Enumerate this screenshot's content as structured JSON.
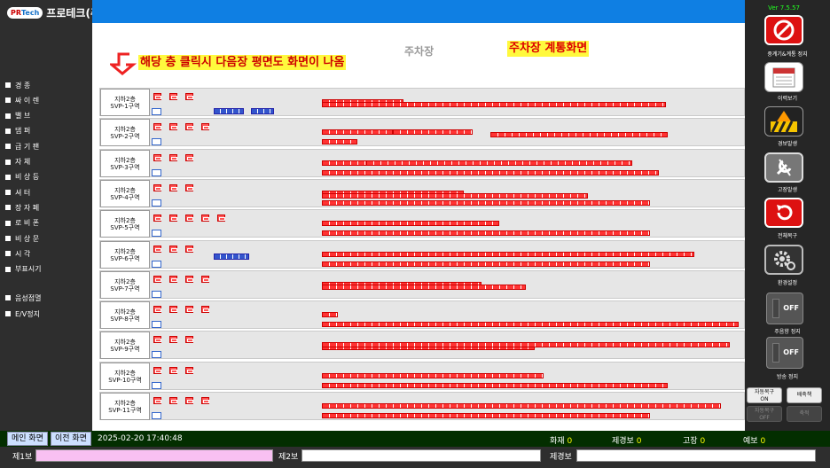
{
  "logo": {
    "pr": "PR",
    "tech": "Tech",
    "company": "프로테크(주)"
  },
  "version": "Ver 7.5.57",
  "annotation": "해당 층 클릭시 다음장 평면도 화면이 나옴",
  "ghost_title": "주차장",
  "screen_title": "주차장 계통화면",
  "legend": [
    "경   종",
    "싸 이 렌",
    "밸   브",
    "댐   퍼",
    "급 기 팬",
    "자   체",
    "비 상 등",
    "셔   터",
    "장 자 페",
    "로 비 폰",
    "비 상 문",
    "시   각",
    "부표시기",
    "음성점멸",
    "E/V정지"
  ],
  "floors": [
    {
      "l1": "지하2층",
      "l2": "SVP-1구역"
    },
    {
      "l1": "지하2층",
      "l2": "SVP-2구역"
    },
    {
      "l1": "지하2층",
      "l2": "SVP-3구역"
    },
    {
      "l1": "지하2층",
      "l2": "SVP-4구역"
    },
    {
      "l1": "지하2층",
      "l2": "SVP-5구역"
    },
    {
      "l1": "지하2층",
      "l2": "SVP-6구역"
    },
    {
      "l1": "지하2층",
      "l2": "SVP-7구역"
    },
    {
      "l1": "지하2층",
      "l2": "SVP-8구역"
    },
    {
      "l1": "지하2층",
      "l2": "SVP-9구역"
    },
    {
      "l1": "지하2층",
      "l2": "SVP-10구역"
    },
    {
      "l1": "지하2층",
      "l2": "SVP-11구역"
    }
  ],
  "right": {
    "stop": "중계기&계통 정지",
    "history": "이력보기",
    "alarm": "경보발생",
    "fault": "고장발생",
    "reset": "전체복구",
    "settings": "환경설정",
    "buzzer_stop": "주음향 정지",
    "broadcast_stop": "방송 정지",
    "off": "OFF",
    "auto_on_1": "자동복구",
    "auto_on_2": "ON",
    "exhaust": "배축책",
    "auto_off_1": "자동복구",
    "auto_off_2": "OFF",
    "unknown": "축적"
  },
  "status": {
    "main": "메인 화면",
    "prev": "이전 화면",
    "datetime": "2025-02-20 17:40:48",
    "fire_label": "화재",
    "fire": "0",
    "gas_label": "제경보",
    "gas": "0",
    "fault_label": "고장",
    "fault": "0",
    "pre_label": "예보",
    "pre": "0"
  },
  "bottom": {
    "b1": "제1보",
    "b2": "제2보",
    "b3": "제경보"
  },
  "colors": {
    "topbar": "#0f7fe3",
    "highlight": "#fff93d",
    "device": "#ff3333",
    "status_bar": "#032e00"
  }
}
